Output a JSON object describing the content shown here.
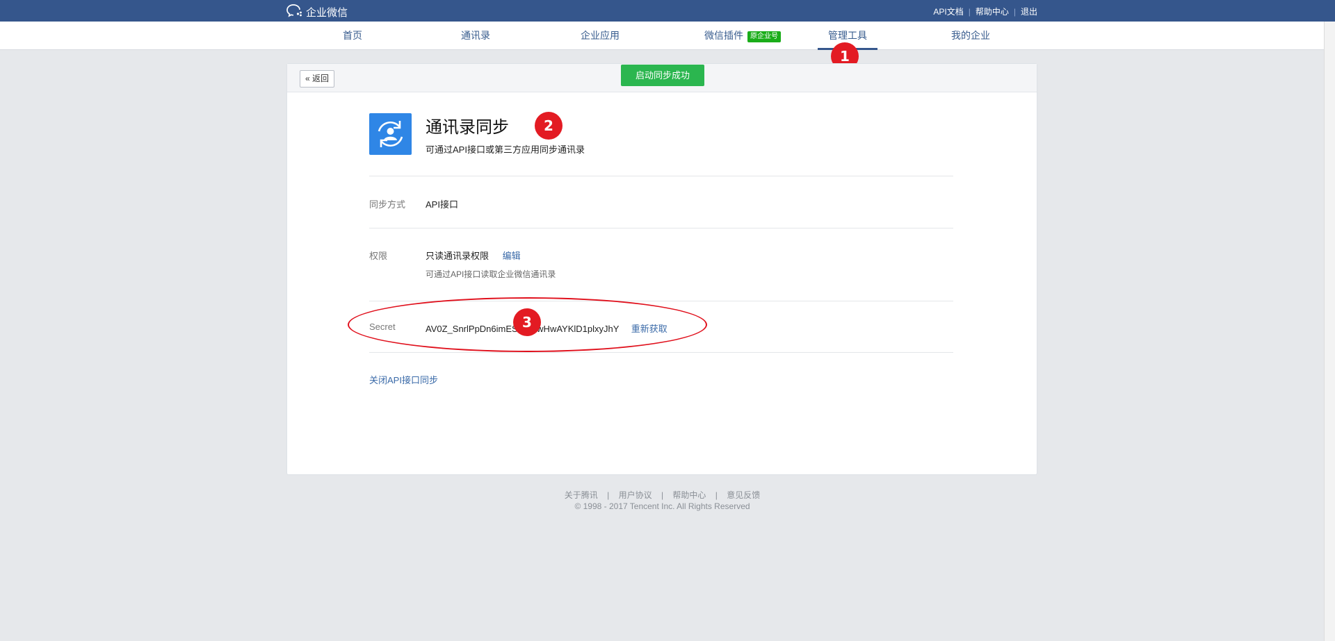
{
  "brand": {
    "name": "企业微信",
    "icon": "chat-bubbles-icon"
  },
  "top_links": [
    "API文档",
    "帮助中心",
    "退出"
  ],
  "nav": {
    "items": [
      {
        "label": "首页"
      },
      {
        "label": "通讯录"
      },
      {
        "label": "企业应用"
      },
      {
        "label": "微信插件",
        "badge": "原企业号"
      },
      {
        "label": "管理工具",
        "active": true
      },
      {
        "label": "我的企业"
      }
    ]
  },
  "panel": {
    "back_label": "返回",
    "toast": "启动同步成功"
  },
  "app": {
    "icon": "sync-contacts-icon",
    "title": "通讯录同步",
    "description": "可通过API接口或第三方应用同步通讯录"
  },
  "sync_mode": {
    "label": "同步方式",
    "value": "API接口"
  },
  "permission": {
    "label": "权限",
    "value": "只读通讯录权限",
    "edit_label": "编辑",
    "note": "可通过API接口读取企业微信通讯录"
  },
  "secret": {
    "label": "Secret",
    "value": "AV0Z_SnrlPpDn6imESl8KSwHwAYKlD1plxyJhY",
    "refresh_label": "重新获取"
  },
  "close_link": "关闭API接口同步",
  "annotations": [
    "1",
    "2",
    "3"
  ],
  "annotation_color": "#e31b23",
  "footer": {
    "links": [
      "关于腾讯",
      "用户协议",
      "帮助中心",
      "意见反馈"
    ],
    "copyright": "© 1998 - 2017 Tencent Inc. All Rights Reserved"
  }
}
